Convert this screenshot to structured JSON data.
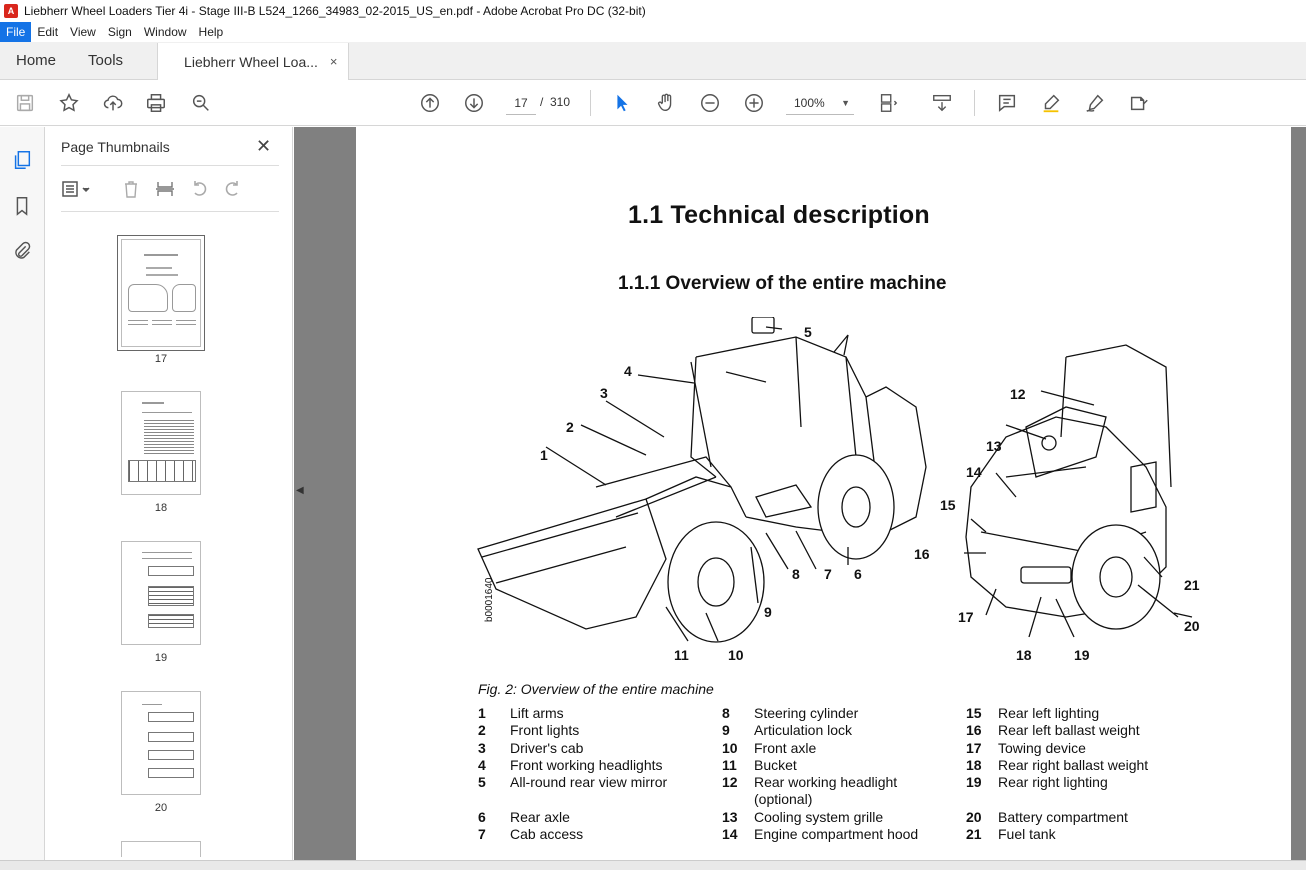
{
  "window": {
    "title": "Liebherr Wheel Loaders Tier 4i - Stage III-B L524_1266_34983_02-2015_US_en.pdf - Adobe Acrobat Pro DC (32-bit)"
  },
  "menu": [
    "File",
    "Edit",
    "View",
    "Sign",
    "Window",
    "Help"
  ],
  "tabs": {
    "home": "Home",
    "tools": "Tools",
    "document": "Liebherr Wheel Loa...",
    "document_close": "×"
  },
  "toolbar": {
    "current_page": "17",
    "page_separator": "/",
    "total_pages": "310",
    "zoom": "100%",
    "icons": [
      "save-icon",
      "bookmark-star-icon",
      "upload-icon",
      "print-icon",
      "search-zoom-icon",
      "page-up-icon",
      "page-down-icon",
      "select-cursor-icon",
      "hand-icon",
      "zoom-out-icon",
      "zoom-in-icon",
      "fit-page-icon",
      "scroll-mode-icon",
      "comment-icon",
      "highlight-icon",
      "sign-icon",
      "fill-sign-icon"
    ]
  },
  "thumbnail_panel": {
    "title": "Page Thumbnails",
    "close": "✕",
    "pages": [
      {
        "number": "17",
        "selected": true
      },
      {
        "number": "18",
        "selected": false
      },
      {
        "number": "19",
        "selected": false
      },
      {
        "number": "20",
        "selected": false
      }
    ]
  },
  "document": {
    "heading": "1.1  Technical description",
    "subheading": "1.1.1   Overview of the entire machine",
    "figure_code": "b0001640",
    "caption": "Fig. 2: Overview of the entire machine",
    "callouts": [
      "1",
      "2",
      "3",
      "4",
      "5",
      "6",
      "7",
      "8",
      "9",
      "10",
      "11",
      "12",
      "13",
      "14",
      "15",
      "16",
      "17",
      "18",
      "19",
      "20",
      "21"
    ],
    "legend": [
      [
        {
          "num": "1",
          "text": "Lift arms"
        },
        {
          "num": "2",
          "text": "Front lights"
        },
        {
          "num": "3",
          "text": "Driver's cab"
        },
        {
          "num": "4",
          "text": "Front working headlights"
        },
        {
          "num": "5",
          "text": "All-round rear view mirror"
        },
        {
          "num": "",
          "text": ""
        },
        {
          "num": "6",
          "text": "Rear axle"
        },
        {
          "num": "7",
          "text": "Cab access"
        }
      ],
      [
        {
          "num": "8",
          "text": "Steering cylinder"
        },
        {
          "num": "9",
          "text": "Articulation lock"
        },
        {
          "num": "10",
          "text": "Front axle"
        },
        {
          "num": "11",
          "text": "Bucket"
        },
        {
          "num": "12",
          "text": "Rear working headlight"
        },
        {
          "num": "",
          "text": "(optional)"
        },
        {
          "num": "13",
          "text": "Cooling system grille"
        },
        {
          "num": "14",
          "text": "Engine compartment hood"
        }
      ],
      [
        {
          "num": "15",
          "text": "Rear left lighting"
        },
        {
          "num": "16",
          "text": "Rear left ballast weight"
        },
        {
          "num": "17",
          "text": "Towing device"
        },
        {
          "num": "18",
          "text": "Rear right ballast weight"
        },
        {
          "num": "19",
          "text": "Rear right lighting"
        },
        {
          "num": "",
          "text": ""
        },
        {
          "num": "20",
          "text": "Battery compartment"
        },
        {
          "num": "21",
          "text": "Fuel tank"
        }
      ]
    ]
  }
}
